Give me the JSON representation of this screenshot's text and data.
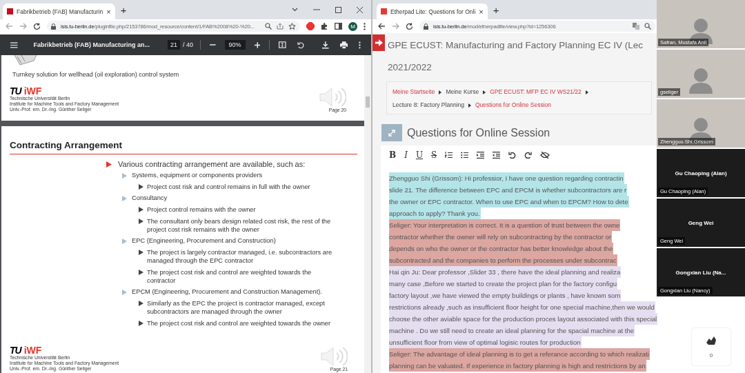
{
  "left_window": {
    "tab": {
      "title": "Fabrikbetrieb (FAB) Manufacturin",
      "close": "×"
    },
    "new_tab": "+",
    "address": {
      "host": "isis.tu-berlin.de",
      "path": "/pluginfile.php/2153786/mod_resource/content/1/FAB%2008%20-%20..."
    },
    "profile": "M",
    "pdf_toolbar": {
      "title": "Fabrikbetrieb (FAB) Manufacturing an...",
      "page": "21",
      "page_total": "/ 40",
      "zoom": "90%"
    },
    "page_20": {
      "caption": "Turnkey solution for wellhead (oil exploration) control system",
      "logo_tu": "TU",
      "logo_iwf": "iWF",
      "footer": [
        "Technische Universität Berlin",
        "Institute for Machine Tools and Factory Management",
        "Univ.-Prof. em. Dr.-Ing. Günther Seliger"
      ],
      "page_label": "Page 20"
    },
    "page_21": {
      "title": "Contracting Arrangement",
      "bullets": [
        {
          "text": "Various contracting arrangement are available, such as:",
          "children": [
            {
              "text": "Systems, equipment or components providers",
              "children": [
                {
                  "text": "Project cost risk and control remains in full with the owner"
                }
              ]
            },
            {
              "text": "Consultancy",
              "children": [
                {
                  "text": "Project control remains with the owner"
                },
                {
                  "text": "The consultant only bears design related cost risk, the rest of the project cost risk remains with the owner"
                }
              ]
            },
            {
              "text": "EPC (Engineering, Procurement and Construction)",
              "children": [
                {
                  "text": "The project is largely contractor managed, i.e. subcontractors are managed through the EPC contractor"
                },
                {
                  "text": "The project cost risk and control are weighted towards the contractor"
                }
              ]
            },
            {
              "text": "EPCM (Engineering, Procurement and Construction Management).",
              "children": [
                {
                  "text": "Similarly as the EPC the project is contractor managed, except subcontractors are managed through the owner"
                },
                {
                  "text": "The project cost risk and control are weighted towards the owner"
                }
              ]
            }
          ]
        }
      ],
      "logo_tu": "TU",
      "logo_iwf": "iWF",
      "footer": [
        "Technische Universität Berlin",
        "Institute for Machine Tools and Factory Management",
        "Univ.-Prof. em. Dr.-Ing. Günther Seliger"
      ],
      "page_label": "Page 21"
    }
  },
  "right_window": {
    "tab": {
      "title": "Etherpad Lite: Questions for Onli",
      "close": "×"
    },
    "new_tab": "+",
    "address": {
      "host": "isis.tu-berlin.de",
      "path": "/mod/etherpadlite/view.php?id=1256306"
    },
    "course_title": [
      "GPE ECUST: Manufacturing and Factory Planning EC IV (Lec",
      "2021/2022"
    ],
    "breadcrumb": [
      {
        "label": "Meine Startseite",
        "link": true
      },
      {
        "label": "Meine Kurse",
        "link": false
      },
      {
        "label": "GPE ECUST: MFP EC IV WS21/22",
        "link": true
      },
      {
        "label": "Lecture 8: Factory Planning",
        "link": false
      },
      {
        "label": "Questions for Online Session",
        "link": true
      }
    ],
    "heading": "Questions for Online Session",
    "format_buttons": [
      "B",
      "I",
      "U",
      "S"
    ],
    "pad": {
      "blocks": [
        {
          "color": "#b3e4e8",
          "lines": [
            "Zhengguo Shi (Grissom): Hi professior, I have one question regarding contractin",
            "slide 21. The difference between EPC and EPCM is whether subcontractors are r",
            "the owner or EPC contractor. When to use EPC and when to EPCM? How to dete",
            "approach to apply? Thank you."
          ]
        },
        {
          "color": "#dca6a1",
          "lines": [
            "Seliger: Your interpretation is correct. It is a question of trust between the owne",
            "contractor whether the owner will rely on subcontracting by the contractor or",
            "depends on who the owner or the contractor has better knowledge about the",
            "subcontracted and the companies to perform the processes under subcontrac"
          ]
        },
        {
          "color": "#e4def0",
          "lines": [
            "Hai qin Ju: Dear professor ,Slider 33 , there have the ideal planning and realiza",
            "many case ,Before we started to create the project plan for the factory configu",
            "factory layout ,we have viewed the empty buildings or plants , have known som",
            "restrictions already ,such as insufficient floor height for one special machine,then we would",
            "choose the other aviable space for the production proces layout associated with this special",
            "machine . Do  we still need to  create an ideal planning for the spacial machine at the",
            "unsufficient floor from view of optimal logisic routes for production"
          ]
        },
        {
          "color": "#dca6a1",
          "lines": [
            "Seliger: The advantage of ideal planning is to get a referance according to which realizati",
            "planning can be valuated. If experience in factory planning is high and restrictions by an"
          ]
        }
      ]
    }
  },
  "video_tiles": [
    {
      "name": "Safran, Mustafa Anil",
      "video": true
    },
    {
      "name": "gseliger",
      "video": true
    },
    {
      "name": "Zhengguo.Shi.Grissom",
      "video": true
    },
    {
      "name": "Gu Chaoping (Alan)",
      "center": "Gu Chaoping (Alan)",
      "video": false
    },
    {
      "name": "Geng Wei",
      "center": "Geng Wei",
      "video": false
    },
    {
      "name": "Gongxian Liu  (Nancy)",
      "center": "Gongxian Liu  (Na...",
      "video": false
    }
  ],
  "reaction_widget": {
    "count": "0"
  }
}
